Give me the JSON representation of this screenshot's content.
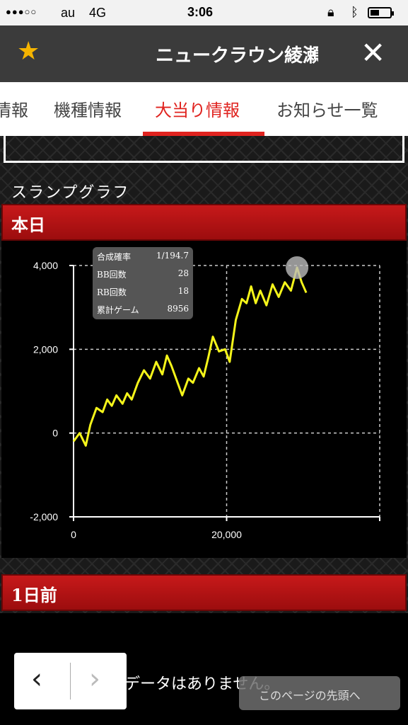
{
  "status_bar": {
    "signal": "●●●○○",
    "carrier": "au",
    "network": "4G",
    "time": "3:06",
    "rotation_icon": "rotation-lock-icon",
    "bluetooth_icon": "bluetooth-icon",
    "battery_icon": "battery-icon"
  },
  "header": {
    "title": "ニュークラウン綾瀬",
    "star_icon": "star-icon",
    "close_icon": "close-icon",
    "colors": {
      "star": "#f5b400",
      "bar": "#3b3b3b"
    }
  },
  "tabs": [
    {
      "label": "情報"
    },
    {
      "label": "機種情報"
    },
    {
      "label": "大当り情報",
      "active": true
    },
    {
      "label": "お知らせ一覧"
    }
  ],
  "accent_color": "#e0231f",
  "section_label": "スランプグラフ",
  "today_label": "本日",
  "tooltip": {
    "rows": [
      {
        "label": "合成確率",
        "value": "1/194.7"
      },
      {
        "label": "BB回数",
        "value": "28"
      },
      {
        "label": "RB回数",
        "value": "18"
      },
      {
        "label": "累計ゲーム",
        "value": "8956"
      }
    ]
  },
  "chart_data": {
    "type": "line",
    "title": "",
    "xlabel": "",
    "ylabel": "",
    "x_ticks": [
      "0",
      "20,000"
    ],
    "y_ticks": [
      "4,000",
      "2,000",
      "0",
      "-2,000"
    ],
    "xlim": [
      0,
      40000
    ],
    "ylim": [
      -2000,
      4000
    ],
    "grid": true,
    "line_color": "#f5f51a",
    "series": [
      {
        "x": [
          0,
          800,
          1600,
          2200,
          3000,
          3800,
          4400,
          5000,
          5600,
          6400,
          7000,
          7600,
          8400,
          9200,
          10000,
          10800,
          11600,
          12200,
          12800,
          13400,
          14200,
          15000,
          15600,
          16400,
          17000,
          17600,
          18200,
          19000,
          19800,
          20400,
          21200,
          22000,
          22600,
          23200,
          23800,
          24400,
          25200,
          26000,
          26800,
          27600,
          28400,
          29200,
          29800,
          30400
        ],
        "y": [
          -200,
          0,
          -300,
          200,
          600,
          500,
          800,
          650,
          900,
          700,
          950,
          800,
          1200,
          1500,
          1300,
          1700,
          1400,
          1850,
          1600,
          1300,
          900,
          1300,
          1200,
          1550,
          1350,
          1800,
          2300,
          1950,
          2000,
          1700,
          2700,
          3200,
          3100,
          3500,
          3100,
          3400,
          3050,
          3550,
          3250,
          3600,
          3400,
          3950,
          3600,
          3350
        ]
      }
    ]
  },
  "prev_day_label": "1日前",
  "no_data_text": "データはありません。",
  "back_to_top_text": "このページの先頭へ",
  "nav": {
    "prev_icon": "chevron-left-icon",
    "next_icon": "chevron-right-icon"
  }
}
